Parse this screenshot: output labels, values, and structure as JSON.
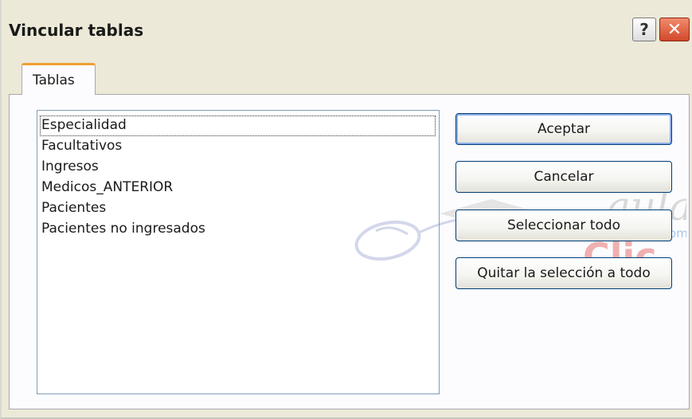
{
  "window": {
    "title": "Vincular tablas",
    "help_label": "?",
    "close_label": "✕"
  },
  "tabs": [
    {
      "label": "Tablas",
      "selected": true
    }
  ],
  "table_list": {
    "items": [
      {
        "label": "Especialidad",
        "focused": true
      },
      {
        "label": "Facultativos"
      },
      {
        "label": "Ingresos"
      },
      {
        "label": "Medicos_ANTERIOR"
      },
      {
        "label": "Pacientes"
      },
      {
        "label": "Pacientes no ingresados"
      }
    ]
  },
  "buttons": {
    "accept": "Aceptar",
    "cancel": "Cancelar",
    "select_all": "Seleccionar todo",
    "deselect_all": "Quitar la selección a todo"
  },
  "watermark": {
    "line1": "aula",
    "line2": "Clic",
    "suffix": ".com"
  },
  "colors": {
    "dialog_bg": "#ece9d8",
    "tab_accent": "#f0a030",
    "button_border": "#003c74",
    "close_red": "#d2482a",
    "watermark_red": "#e08080"
  }
}
